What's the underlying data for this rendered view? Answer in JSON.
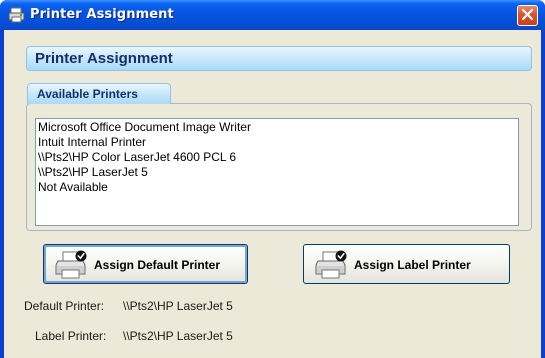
{
  "window": {
    "title": "Printer Assignment",
    "icon": "printer-app-icon"
  },
  "banner": {
    "title": "Printer Assignment"
  },
  "printers_section": {
    "tab_label": "Available Printers",
    "items": [
      "Microsoft Office Document Image Writer",
      "Intuit Internal Printer",
      "\\\\Pts2\\HP Color LaserJet 4600 PCL 6",
      "\\\\Pts2\\HP LaserJet 5",
      "Not Available"
    ]
  },
  "buttons": {
    "assign_default": {
      "label": "Assign Default Printer",
      "icon": "printer-check-icon"
    },
    "assign_label": {
      "label": "Assign Label Printer",
      "icon": "printer-check-icon"
    }
  },
  "status": {
    "default_label": "Default Printer:",
    "default_value": "\\\\Pts2\\HP LaserJet 5",
    "label_label": "Label Printer:",
    "label_value": "\\\\Pts2\\HP LaserJet 5"
  },
  "colors": {
    "titlebar": "#0654e4",
    "client_bg": "#ece9d8",
    "banner_bg": "#cbe9fc",
    "banner_text": "#14306b",
    "close_button": "#d9542b"
  }
}
